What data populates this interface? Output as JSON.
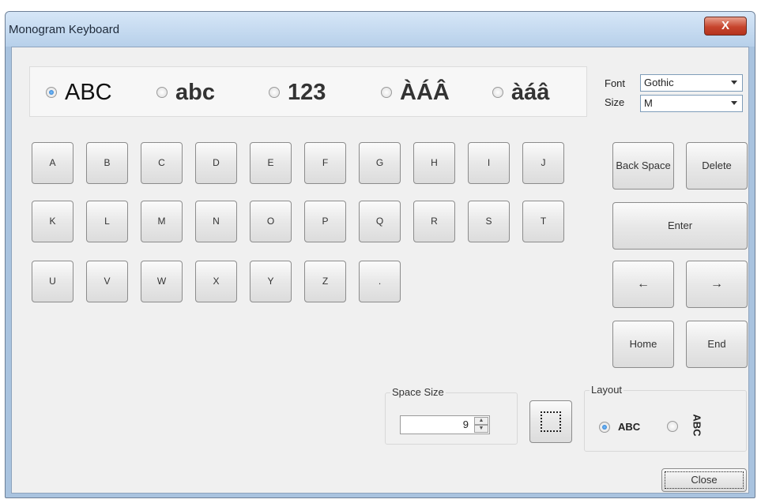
{
  "window": {
    "title": "Monogram Keyboard",
    "close_glyph": "X"
  },
  "modes": [
    {
      "label": "ABC",
      "selected": true
    },
    {
      "label": "abc",
      "selected": false
    },
    {
      "label": "123",
      "selected": false
    },
    {
      "label": "ÀÁÂ",
      "selected": false
    },
    {
      "label": "àáâ",
      "selected": false
    }
  ],
  "font": {
    "label": "Font",
    "value": "Gothic"
  },
  "size": {
    "label": "Size",
    "value": "M"
  },
  "keys": {
    "row1": [
      "A",
      "B",
      "C",
      "D",
      "E",
      "F",
      "G",
      "H",
      "I",
      "J"
    ],
    "row2": [
      "K",
      "L",
      "M",
      "N",
      "O",
      "P",
      "Q",
      "R",
      "S",
      "T"
    ],
    "row3": [
      "U",
      "V",
      "W",
      "X",
      "Y",
      "Z",
      "."
    ]
  },
  "controls": {
    "backspace": "Back Space",
    "delete": "Delete",
    "enter": "Enter",
    "left": "←",
    "right": "→",
    "home": "Home",
    "end": "End"
  },
  "space_size": {
    "label": "Space Size",
    "value": "9"
  },
  "layout": {
    "label": "Layout",
    "horizontal": "ABC",
    "vertical": "ABC",
    "selected": "horizontal"
  },
  "close_button": "Close"
}
